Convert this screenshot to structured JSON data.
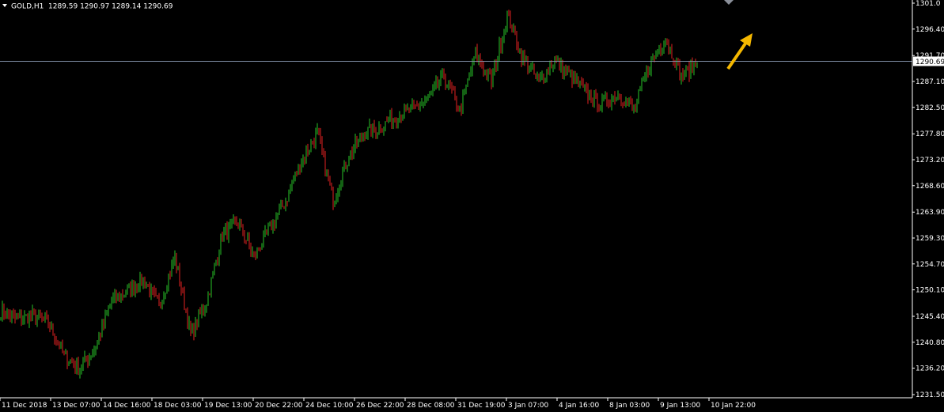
{
  "header": {
    "symbol": "GOLD,H1",
    "ohlc": "1289.59 1290.97 1289.14 1290.69"
  },
  "colors": {
    "background": "#000000",
    "bull": "#27c427",
    "bear": "#e52222",
    "axis": "#ffffff",
    "price_line": "#7f8fa6",
    "price_badge_bg": "#ffffff",
    "price_badge_text": "#000000",
    "arrow": "#f5b800"
  },
  "icons": [
    "dropdown-triangle-icon",
    "up-right-arrow-icon",
    "diamond-marker-icon"
  ],
  "chart_data": {
    "type": "candlestick",
    "title": "GOLD,H1",
    "ylim": [
      1231.5,
      1301.0
    ],
    "y_ticks": [
      "1301.0",
      "1296.40",
      "1291.70",
      "1287.10",
      "1282.50",
      "1277.80",
      "1273.20",
      "1268.60",
      "1263.90",
      "1259.30",
      "1254.70",
      "1250.10",
      "1245.40",
      "1240.80",
      "1236.20",
      "1231.50"
    ],
    "x_ticks": [
      "11 Dec 2018",
      "13 Dec 07:00",
      "14 Dec 16:00",
      "18 Dec 03:00",
      "19 Dec 13:00",
      "20 Dec 22:00",
      "24 Dec 10:00",
      "26 Dec 22:00",
      "28 Dec 08:00",
      "31 Dec 19:00",
      "3 Jan 07:00",
      "4 Jan 16:00",
      "8 Jan 03:00",
      "9 Jan 13:00",
      "10 Jan 22:00"
    ],
    "current_price": "1290.69",
    "candles_per_tick": 32,
    "anchors": [
      1246.5,
      1244.8,
      1245.5,
      1244.2,
      1238.5,
      1236.0,
      1240.0,
      1248.0,
      1250.0,
      1252.0,
      1247.0,
      1256.0,
      1242.0,
      1248.0,
      1260.0,
      1262.0,
      1256.0,
      1261.0,
      1266.0,
      1273.0,
      1278.0,
      1266.0,
      1274.0,
      1278.0,
      1279.0,
      1281.0,
      1282.0,
      1284.0,
      1288.0,
      1282.0,
      1292.0,
      1287.0,
      1299.0,
      1291.0,
      1287.0,
      1291.0,
      1288.0,
      1285.0,
      1283.0,
      1285.0,
      1282.0,
      1290.0,
      1295.0,
      1288.0,
      1290.5
    ]
  }
}
